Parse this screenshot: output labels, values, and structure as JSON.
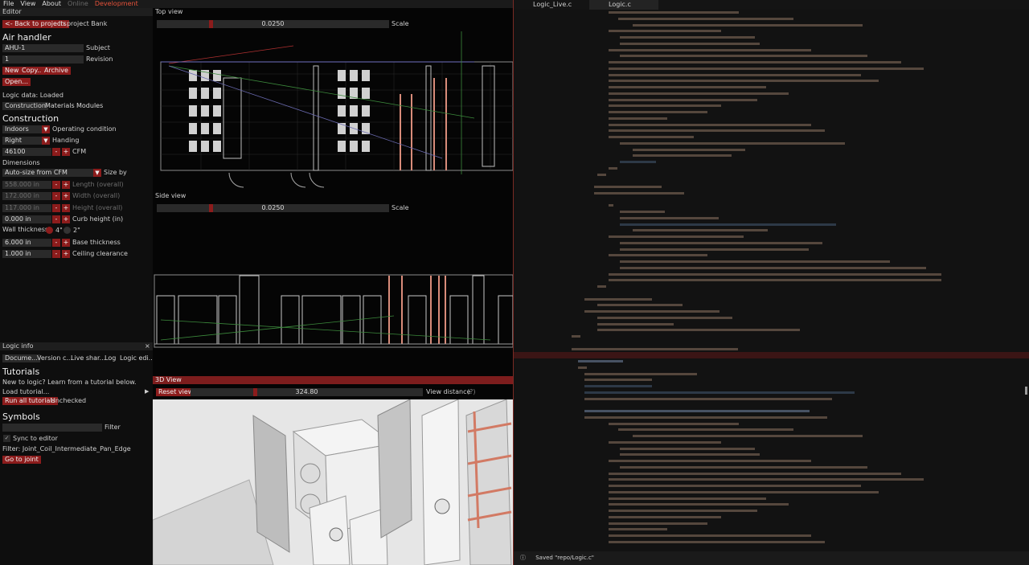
{
  "menu": {
    "file": "File",
    "view": "View",
    "about": "About",
    "online": "Online",
    "development": "Development"
  },
  "editor_panel": {
    "title": "Editor",
    "back_button": "<- Back to projects",
    "project_label": "In project Bank",
    "heading": "Air handler",
    "subject_value": "AHU-1",
    "subject_label": "Subject",
    "revision_value": "1",
    "revision_label": "Revision",
    "new_button": "New",
    "copy_button": "Copy...",
    "archive_button": "Archive",
    "open_button": "Open...",
    "logic_status": "Logic data: Loaded",
    "tabs": [
      "Construction",
      "Materials",
      "Modules"
    ]
  },
  "construction": {
    "heading": "Construction",
    "operating_value": "Indoors",
    "operating_label": "Operating condition",
    "handing_value": "Right",
    "handing_label": "Handing",
    "cfm_value": "46100",
    "cfm_label": "CFM",
    "dimensions_label": "Dimensions",
    "size_by_value": "Auto-size from CFM",
    "size_by_label": "Size by",
    "length_value": "558.000 in",
    "length_label": "Length (overall)",
    "width_value": "172.000 in",
    "width_label": "Width (overall)",
    "height_value": "117.000 in",
    "height_label": "Height (overall)",
    "curb_value": "0.000 in",
    "curb_label": "Curb height (in)",
    "wall_label": "Wall thickness",
    "wall_opt1": "4\"",
    "wall_opt2": "2\"",
    "base_value": "6.000 in",
    "base_label": "Base thickness",
    "ceiling_value": "1.000 in",
    "ceiling_label": "Ceiling clearance",
    "minus": "-",
    "plus": "+"
  },
  "logic_info": {
    "title": "Logic info",
    "close": "×",
    "tabs": [
      "Docume...",
      "Version c...",
      "Live shar...",
      "Log",
      "Logic edi..."
    ]
  },
  "tutorials": {
    "heading": "Tutorials",
    "intro": "New to logic? Learn from a tutorial below.",
    "load": "Load tutorial...",
    "run_button": "Run all tutorials",
    "status": "Unchecked"
  },
  "symbols": {
    "heading": "Symbols",
    "filter_label": "Filter",
    "sync_label": "Sync to editor",
    "filter_text": "Filter: Joint_Coil_Intermediate_Pan_Edge",
    "goto_button": "Go to joint"
  },
  "views": {
    "top_title": "Top view",
    "top_scale_value": "0.0250",
    "top_scale_label": "Scale",
    "side_title": "Side view",
    "side_scale_value": "0.0250",
    "side_scale_label": "Scale",
    "view3d_title": "3D View",
    "reset_button": "Reset view",
    "distance_value": "324.80",
    "distance_label": "View distance",
    "distance_help": "(?)"
  },
  "code_editor": {
    "tabs": [
      "Logic_Live.c",
      "Logic.c"
    ],
    "status": "Saved \"repo/Logic.c\""
  },
  "colors": {
    "accent": "#8c1c1c",
    "header_red": "#7d1d1d",
    "dev_text": "#e5523a"
  }
}
